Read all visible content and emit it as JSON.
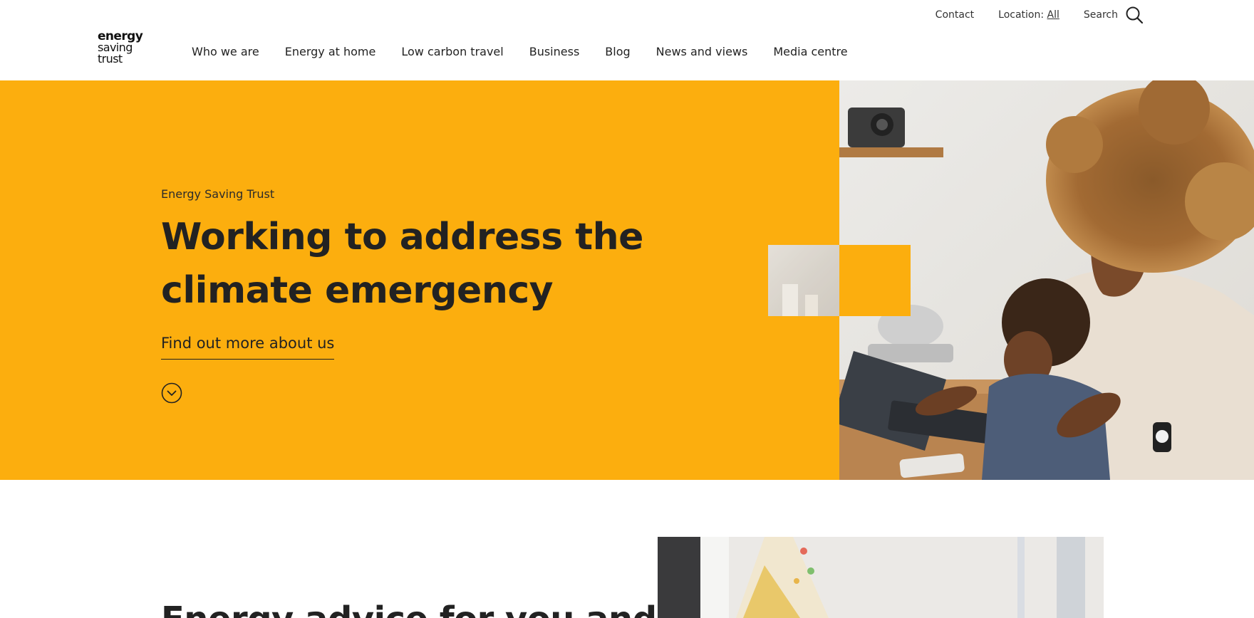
{
  "logo": {
    "line1": "energy",
    "line2": "saving",
    "line3": "trust"
  },
  "utility": {
    "contact": "Contact",
    "location_label": "Location:",
    "location_value": "All",
    "search": "Search"
  },
  "nav": {
    "items": [
      {
        "label": "Who we are"
      },
      {
        "label": "Energy at home"
      },
      {
        "label": "Low carbon travel"
      },
      {
        "label": "Business"
      },
      {
        "label": "Blog"
      },
      {
        "label": "News and views"
      },
      {
        "label": "Media centre"
      }
    ]
  },
  "hero": {
    "eyebrow": "Energy Saving Trust",
    "title": "Working to address the climate emergency",
    "link": "Find out more about us",
    "scroll_icon": "chevron-down-circle-icon",
    "bg_color": "#fcae0e",
    "text_color": "#222222"
  },
  "section2": {
    "heading": "Energy advice for you and"
  },
  "icons": {
    "search": "search-icon",
    "scroll": "chevron-down-circle-icon"
  }
}
